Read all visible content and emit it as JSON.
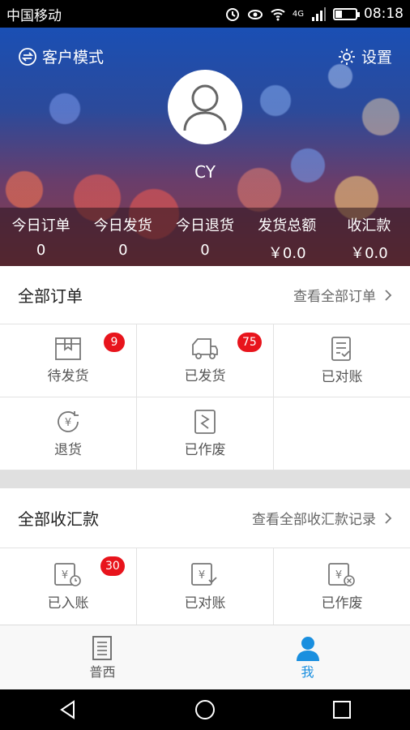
{
  "status_bar": {
    "carrier": "中国移动",
    "network": "4G",
    "time": "08:18"
  },
  "header": {
    "mode_label": "客户模式",
    "settings_label": "设置",
    "username": "CY",
    "stats": [
      {
        "label": "今日订单",
        "value": "0"
      },
      {
        "label": "今日发货",
        "value": "0"
      },
      {
        "label": "今日退货",
        "value": "0"
      },
      {
        "label": "发货总额",
        "value": "￥0.0"
      },
      {
        "label": "收汇款",
        "value": "￥0.0"
      }
    ]
  },
  "orders": {
    "title": "全部订单",
    "link": "查看全部订单",
    "items": [
      {
        "label": "待发货",
        "badge": "9",
        "icon": "box-icon"
      },
      {
        "label": "已发货",
        "badge": "75",
        "icon": "truck-icon"
      },
      {
        "label": "已对账",
        "icon": "checklist-icon"
      },
      {
        "label": "退货",
        "icon": "refund-yen-icon"
      },
      {
        "label": "已作废",
        "icon": "void-document-icon"
      }
    ]
  },
  "payments": {
    "title": "全部收汇款",
    "link": "查看全部收汇款记录",
    "items": [
      {
        "label": "已入账",
        "badge": "30",
        "icon": "yen-clock-icon"
      },
      {
        "label": "已对账",
        "icon": "yen-check-icon"
      },
      {
        "label": "已作废",
        "icon": "yen-cancel-icon"
      }
    ]
  },
  "tabbar": {
    "tabs": [
      {
        "label": "普西",
        "icon": "document-icon",
        "active": false
      },
      {
        "label": "我",
        "icon": "person-icon",
        "active": true
      }
    ],
    "active_color": "#1a8fdf"
  },
  "colors": {
    "badge": "#e8141c"
  }
}
